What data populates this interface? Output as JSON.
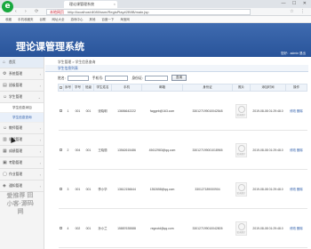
{
  "browser": {
    "logo_text": "e",
    "tab_title": "理论课管理系统",
    "tab_close": "×",
    "window_controls": "— ☐ ✕",
    "nav_icons": "‹ › ⟳ ⌂",
    "address_tag": "本地网页",
    "address_url": "http://localhost:8080/ssm/RegisPlay#2B9B/main.jsp",
    "url_right": "☆ ⋮",
    "bookmarks": [
      "收藏",
      "手机收藏夹",
      "谷歌",
      "网址大全",
      "游戏中心",
      "其他",
      "百度一下",
      "淘宝网"
    ]
  },
  "app": {
    "title": "理论课管理系统",
    "user_info": "您好：admin 退出"
  },
  "sidebar": {
    "items": [
      {
        "label": "首页",
        "icon": "home-icon",
        "glyph": "⌂"
      },
      {
        "label": "系统管理",
        "icon": "gear-icon",
        "glyph": "⚙"
      },
      {
        "label": "班级管理",
        "icon": "folder-icon",
        "glyph": "▤"
      },
      {
        "label": "学生管理",
        "icon": "user-icon",
        "glyph": "☺"
      }
    ],
    "sub_items": [
      {
        "label": "学生信息添加"
      },
      {
        "label": "学生信息查询"
      }
    ],
    "more_items": [
      {
        "label": "教师管理",
        "icon": "user-icon",
        "glyph": "☺"
      },
      {
        "label": "课程管理",
        "icon": "book-icon",
        "glyph": "▥"
      },
      {
        "label": "成绩管理",
        "icon": "chart-icon",
        "glyph": "▦"
      },
      {
        "label": "考勤管理",
        "icon": "calendar-icon",
        "glyph": "▣"
      },
      {
        "label": "作业管理",
        "icon": "doc-icon",
        "glyph": "▢"
      },
      {
        "label": "通知管理",
        "icon": "bell-icon",
        "glyph": "◈"
      }
    ]
  },
  "main": {
    "breadcrumb": "学生管理 > 学生信息查询",
    "panel_title": "学生信息列表",
    "search": {
      "name_label": "姓名:",
      "phone_label": "手机号:",
      "id_label": "身份证:",
      "button": "查询"
    },
    "table": {
      "headers": [
        "",
        "序号",
        "学号",
        "班级",
        "学生姓名",
        "手机",
        "邮箱",
        "身份证",
        "照片",
        "添加时间",
        "操作"
      ],
      "photo_placeholder": "暂无图片",
      "rows": [
        {
          "no": "1",
          "sid": "001",
          "cls": "001",
          "name": "张晓明",
          "phone": "13656642222",
          "email": "fwggeb@163.com",
          "idcard": "330127199010042548",
          "time": "2019-08-08 01:29:48.0",
          "op": "修改 删除"
        },
        {
          "no": "2",
          "sid": "004",
          "cls": "001",
          "name": "王晓丽",
          "phone": "13562615486",
          "email": "45612983@qq.com",
          "idcard": "330127199001018965",
          "time": "2019-08-08 01:29:48.0",
          "op": "修改 删除"
        },
        {
          "no": "3",
          "sid": "001",
          "cls": "001",
          "name": "李小华",
          "phone": "13612156644",
          "email": "1352658@qq.com",
          "idcard": "330127189000904",
          "time": "2019-08-08 01:29:48.0",
          "op": "修改 删除"
        },
        {
          "no": "4",
          "sid": "002",
          "cls": "001",
          "name": "孙小兰",
          "phone": "15887635588",
          "email": "regnotd@qq.com",
          "idcard": "330127199010042805",
          "time": "2019-08-08 01:29:48.0",
          "op": "修改 删除"
        }
      ]
    }
  },
  "watermark": "爱推荐 回小客·源码网"
}
